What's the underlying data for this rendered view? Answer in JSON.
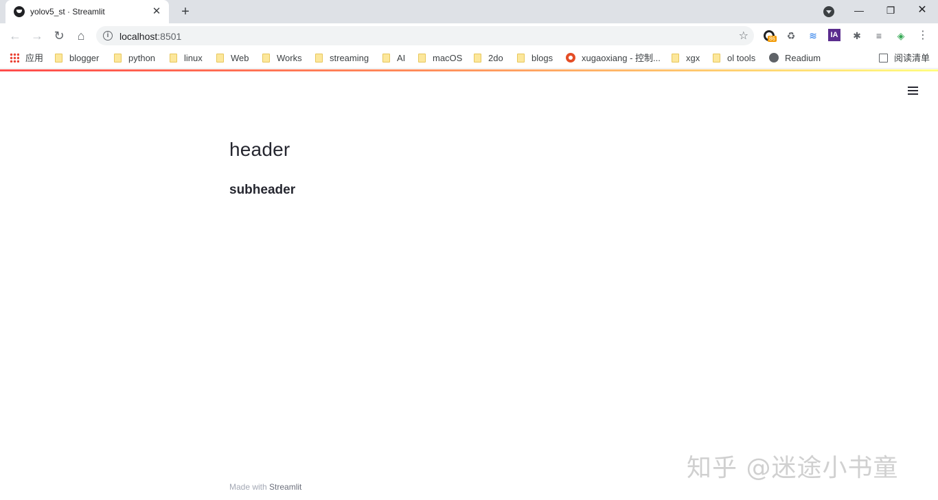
{
  "browser": {
    "tab": {
      "title": "yolov5_st · Streamlit",
      "close": "✕"
    },
    "new_tab": "+",
    "window": {
      "minimize": "—",
      "maximize": "❐",
      "close": "✕"
    },
    "nav": {
      "back": "←",
      "forward": "→",
      "reload": "↻",
      "home": "⌂"
    },
    "url": {
      "host": "localhost",
      "port": ":8501"
    },
    "star": "☆",
    "extensions": {
      "ext1_badge": "86",
      "ext2": "♻",
      "ext3": "≋",
      "ext4": "IA",
      "ext5": "✱",
      "ext6": "≡",
      "ext7": "◈",
      "menu": "⋮"
    }
  },
  "bookmarks": [
    {
      "label": "应用",
      "icon": "apps-icon"
    },
    {
      "label": "blogger",
      "icon": "folder-icon"
    },
    {
      "label": "python",
      "icon": "folder-icon"
    },
    {
      "label": "linux",
      "icon": "folder-icon"
    },
    {
      "label": "Web",
      "icon": "folder-icon"
    },
    {
      "label": "Works",
      "icon": "folder-icon"
    },
    {
      "label": "streaming",
      "icon": "folder-icon"
    },
    {
      "label": "AI",
      "icon": "folder-icon"
    },
    {
      "label": "macOS",
      "icon": "folder-icon"
    },
    {
      "label": "2do",
      "icon": "folder-icon"
    },
    {
      "label": "blogs",
      "icon": "folder-icon"
    },
    {
      "label": "xugaoxiang - 控制...",
      "icon": "gear-icon"
    },
    {
      "label": "xgx",
      "icon": "folder-icon"
    },
    {
      "label": "ol tools",
      "icon": "folder-icon"
    },
    {
      "label": "Readium",
      "icon": "globe-icon"
    }
  ],
  "reading_list": "阅读清单",
  "app": {
    "header": "header",
    "subheader": "subheader",
    "footer": {
      "prefix": "Made with ",
      "brand": "Streamlit"
    },
    "watermark": "知乎 @迷途小书童",
    "accent_colors": [
      "#ff4b4b",
      "#fffd80"
    ]
  }
}
